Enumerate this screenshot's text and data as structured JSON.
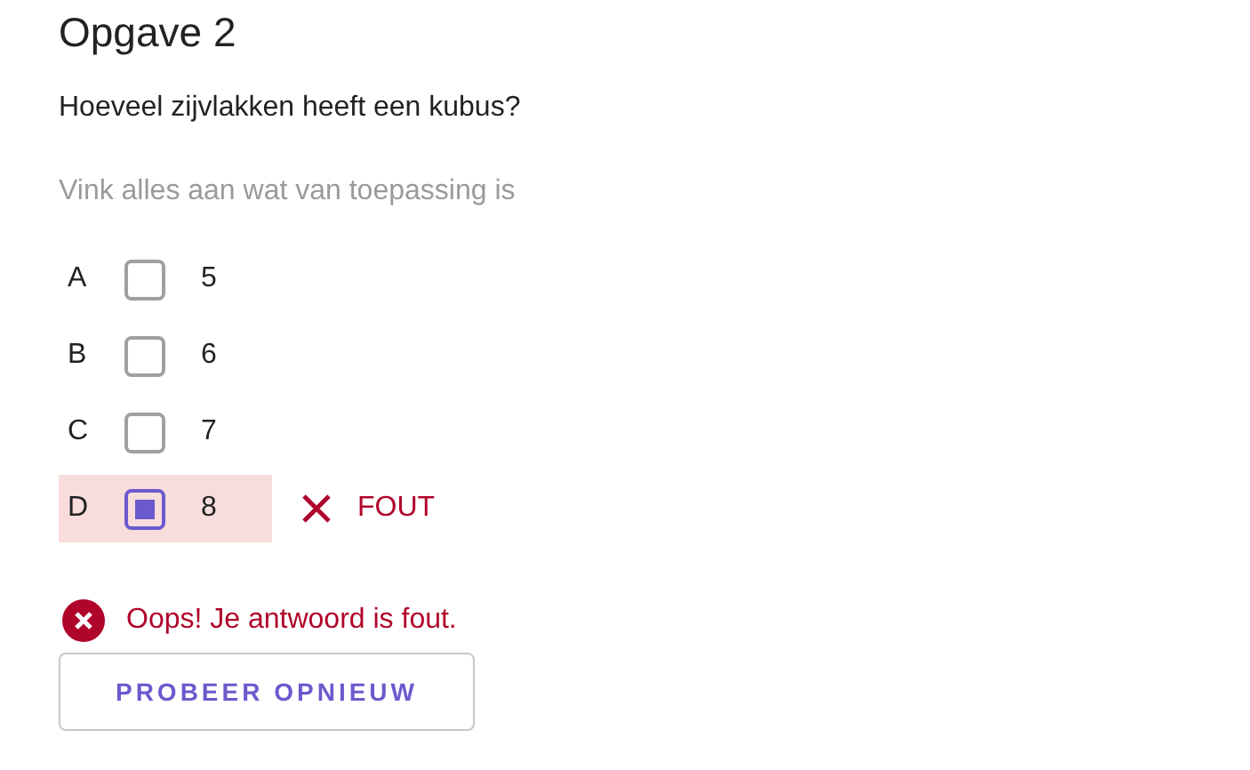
{
  "title": "Opgave 2",
  "question": "Hoeveel zijvlakken heeft een kubus?",
  "hint": "Vink alles aan wat van toepassing is",
  "options": [
    {
      "letter": "A",
      "label": "5",
      "checked": false,
      "wrong": false
    },
    {
      "letter": "B",
      "label": "6",
      "checked": false,
      "wrong": false
    },
    {
      "letter": "C",
      "label": "7",
      "checked": false,
      "wrong": false
    },
    {
      "letter": "D",
      "label": "8",
      "checked": true,
      "wrong": true,
      "feedback": "FOUT"
    }
  ],
  "error": {
    "message": "Oops! Je antwoord is fout."
  },
  "button": "PROBEER OPNIEUW"
}
